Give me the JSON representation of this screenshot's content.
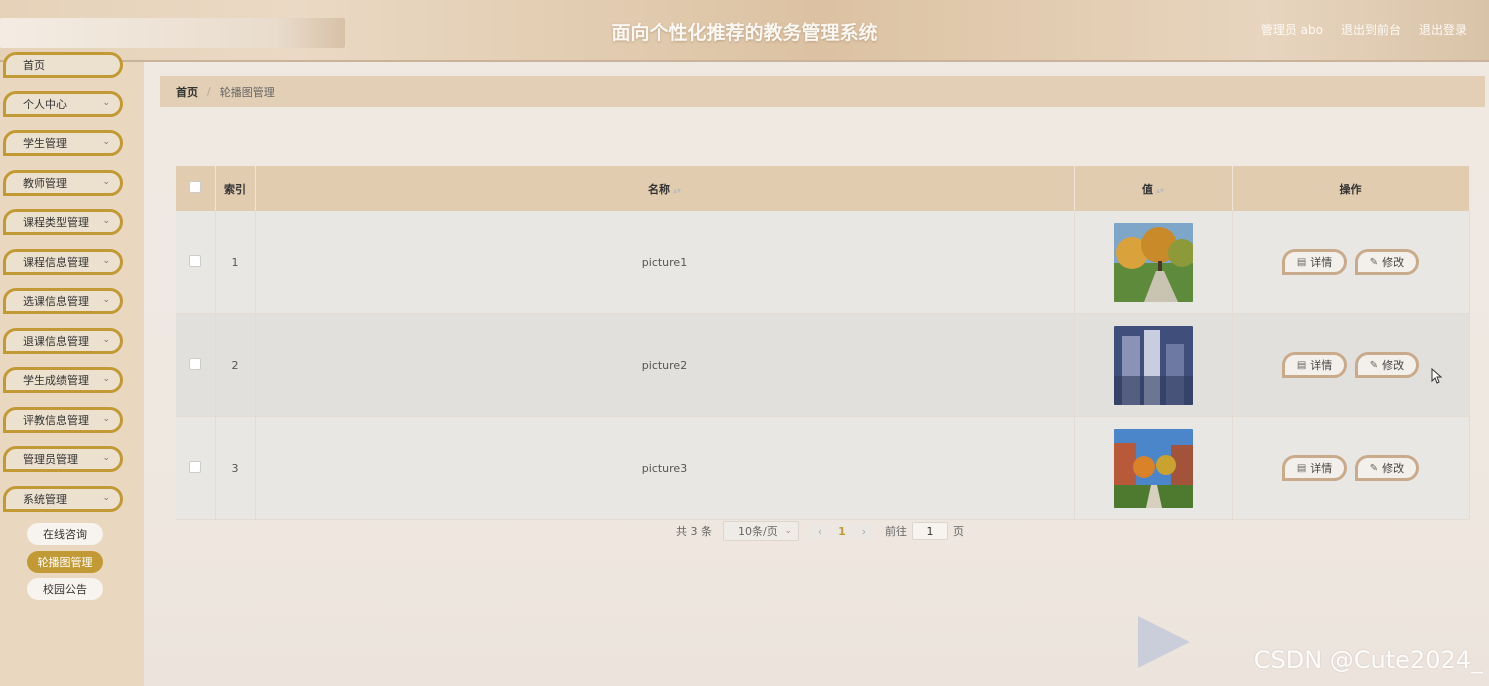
{
  "header": {
    "title": "面向个性化推荐的教务管理系统",
    "user": "管理员 abo",
    "to_front": "退出到前台",
    "logout": "退出登录"
  },
  "sidebar": {
    "items": [
      {
        "label": "首页"
      },
      {
        "label": "个人中心"
      },
      {
        "label": "学生管理"
      },
      {
        "label": "教师管理"
      },
      {
        "label": "课程类型管理"
      },
      {
        "label": "课程信息管理"
      },
      {
        "label": "选课信息管理"
      },
      {
        "label": "退课信息管理"
      },
      {
        "label": "学生成绩管理"
      },
      {
        "label": "评教信息管理"
      },
      {
        "label": "管理员管理"
      },
      {
        "label": "系统管理"
      }
    ],
    "sub_items": [
      {
        "label": "在线咨询",
        "active": false
      },
      {
        "label": "轮播图管理",
        "active": true
      },
      {
        "label": "校园公告",
        "active": false
      }
    ]
  },
  "breadcrumb": {
    "home": "首页",
    "separator": "/",
    "current": "轮播图管理"
  },
  "table": {
    "headers": {
      "index": "索引",
      "name": "名称",
      "value": "值",
      "ops": "操作"
    },
    "rows": [
      {
        "index": "1",
        "name": "picture1",
        "image": "autumn-campus-path"
      },
      {
        "index": "2",
        "name": "picture2",
        "image": "blurred-building"
      },
      {
        "index": "3",
        "name": "picture3",
        "image": "campus-courtyard"
      }
    ],
    "detail_label": "详情",
    "edit_label": "修改"
  },
  "pagination": {
    "total": "共 3 条",
    "page_size": "10条/页",
    "current_page": "1",
    "goto_prefix": "前往",
    "goto_value": "1",
    "goto_suffix": "页"
  },
  "watermark": "CSDN @Cute2024_",
  "colors": {
    "accent": "#c29a35",
    "header_row": "#e1ccb0",
    "sidebar": "#e9d7bf"
  }
}
